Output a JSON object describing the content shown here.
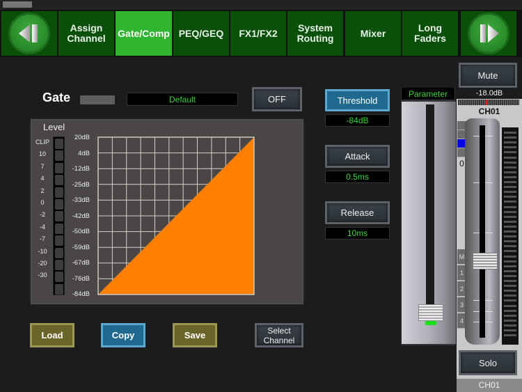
{
  "nav": {
    "prev_icon": "previous-page-icon",
    "next_icon": "next-page-icon",
    "tabs": [
      {
        "label": "Assign\nChannel",
        "active": false
      },
      {
        "label": "Gate/Comp",
        "active": true
      },
      {
        "label": "PEQ/GEQ",
        "active": false
      },
      {
        "label": "FX1/FX2",
        "active": false
      },
      {
        "label": "System\nRouting",
        "active": false
      },
      {
        "label": "Mixer",
        "active": false
      },
      {
        "label": "Long\nFaders",
        "active": false
      }
    ]
  },
  "gate": {
    "title": "Gate",
    "preset": "Default",
    "toggle_label": "OFF"
  },
  "level": {
    "label": "Level",
    "meter_labels": [
      "CLIP",
      "10",
      "7",
      "4",
      "2",
      "0",
      "-2",
      "-4",
      "-7",
      "-10",
      "-20",
      "-30"
    ]
  },
  "graph": {
    "y_labels": [
      "20dB",
      "4dB",
      "-12dB",
      "-25dB",
      "-33dB",
      "-42dB",
      "-50dB",
      "-59dB",
      "-67dB",
      "-76dB",
      "-84dB"
    ],
    "fill_color": "#ff8000",
    "threshold_db": -84
  },
  "params": {
    "threshold": {
      "label": "Threshold",
      "value": "-84dB"
    },
    "attack": {
      "label": "Attack",
      "value": "0.5ms"
    },
    "release": {
      "label": "Release",
      "value": "10ms"
    }
  },
  "parameter_fader": {
    "label": "Parameter",
    "position": 0.03
  },
  "channel": {
    "mute_label": "Mute",
    "level_readout": "-18.0dB",
    "name": "CH01",
    "zero_label": "0",
    "side_buttons": [
      "M",
      "1",
      "2",
      "3",
      "4"
    ],
    "solo_label": "Solo",
    "name_bottom": "CH01",
    "fader_position": 0.37,
    "pan_position": 0.5
  },
  "bottom_buttons": {
    "load": "Load",
    "copy": "Copy",
    "save": "Save",
    "select_channel": "Select\nChannel"
  },
  "colors": {
    "nav_active": "#2fb52f",
    "nav_inactive": "#0a4f0a",
    "value_text": "#3cd23c",
    "gate_curve": "#ff8000"
  }
}
